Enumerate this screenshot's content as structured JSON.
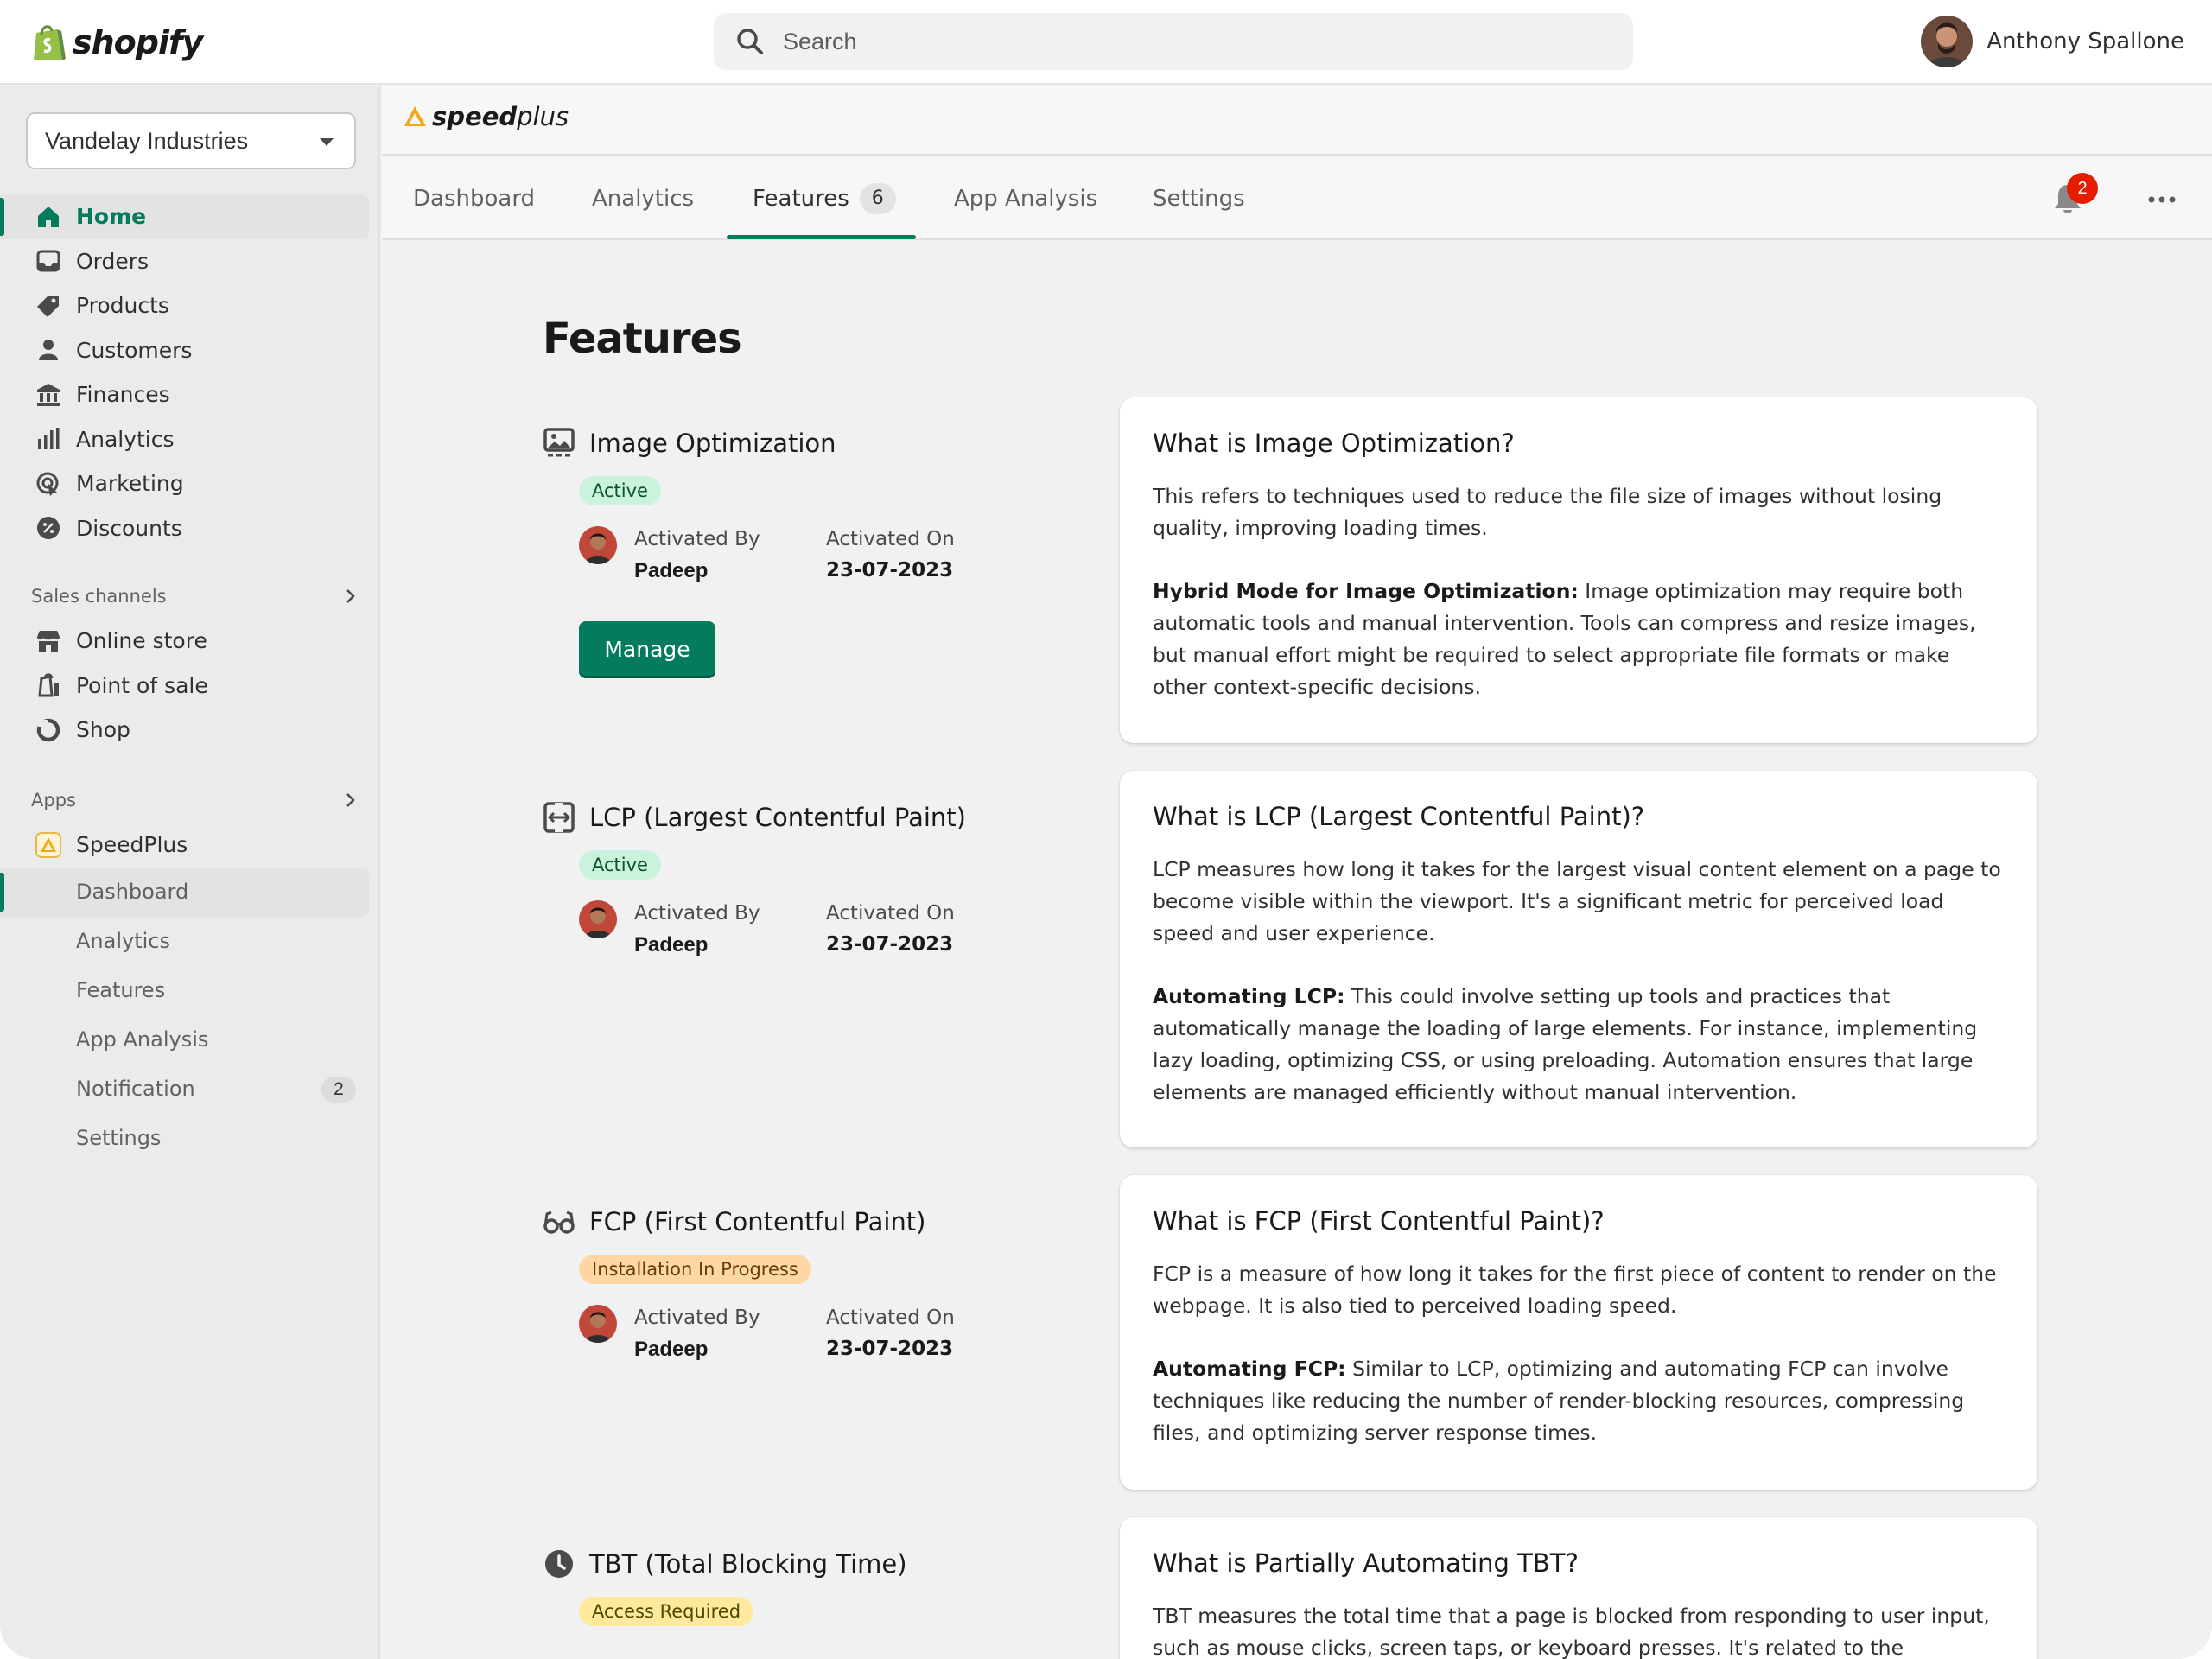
{
  "topbar": {
    "brand": "shopify",
    "search_placeholder": "Search",
    "user_name": "Anthony Spallone"
  },
  "sidebar": {
    "store": "Vandelay Industries",
    "items": [
      {
        "label": "Home",
        "icon": "home-icon"
      },
      {
        "label": "Orders",
        "icon": "inbox-icon"
      },
      {
        "label": "Products",
        "icon": "tag-icon"
      },
      {
        "label": "Customers",
        "icon": "person-icon"
      },
      {
        "label": "Finances",
        "icon": "bank-icon"
      },
      {
        "label": "Analytics",
        "icon": "bar-chart-icon"
      },
      {
        "label": "Marketing",
        "icon": "target-icon"
      },
      {
        "label": "Discounts",
        "icon": "discount-icon"
      }
    ],
    "sales_channels_label": "Sales channels",
    "channels": [
      {
        "label": "Online store",
        "icon": "store-icon"
      },
      {
        "label": "Point of sale",
        "icon": "pos-icon"
      },
      {
        "label": "Shop",
        "icon": "shop-icon"
      }
    ],
    "apps_label": "Apps",
    "app_name": "SpeedPlus",
    "app_items": [
      {
        "label": "Dashboard"
      },
      {
        "label": "Analytics"
      },
      {
        "label": "Features"
      },
      {
        "label": "App Analysis"
      },
      {
        "label": "Notification",
        "count": "2"
      },
      {
        "label": "Settings"
      }
    ]
  },
  "app": {
    "logo_bold": "speed",
    "logo_light": "plus",
    "tabs": [
      {
        "label": "Dashboard"
      },
      {
        "label": "Analytics"
      },
      {
        "label": "Features",
        "badge": "6"
      },
      {
        "label": "App Analysis"
      },
      {
        "label": "Settings"
      }
    ],
    "notification_count": "2"
  },
  "page": {
    "title": "Features",
    "activated_by_label": "Activated By",
    "activated_on_label": "Activated On",
    "features": [
      {
        "name": "Image Optimization",
        "icon": "image-icon",
        "status": "Active",
        "activated_by": "Padeep",
        "activated_on": "23-07-2023",
        "button": "Manage"
      },
      {
        "name": "LCP (Largest Contentful Paint)",
        "icon": "resize-arrows-icon",
        "status": "Active",
        "activated_by": "Padeep",
        "activated_on": "23-07-2023"
      },
      {
        "name": "FCP (First Contentful Paint)",
        "icon": "glasses-icon",
        "status": "Installation In Progress",
        "activated_by": "Padeep",
        "activated_on": "23-07-2023"
      },
      {
        "name": "TBT (Total Blocking Time)",
        "icon": "clock-icon",
        "status": "Access Required"
      }
    ],
    "cards": [
      {
        "title": "What is Image Optimization?",
        "p1": "This refers to techniques used to reduce the file size of images without losing quality, improving loading times.",
        "p2_bold": "Hybrid Mode for Image Optimization:",
        "p2": " Image optimization may require both automatic tools and manual intervention. Tools can compress and resize images, but manual effort might be required to select appropriate file formats or make other context-specific decisions."
      },
      {
        "title": "What is LCP (Largest Contentful Paint)?",
        "p1": "LCP measures how long it takes for the largest visual content element on a page to become visible within the viewport. It's a significant metric for perceived load speed and user experience.",
        "p2_bold": "Automating LCP:",
        "p2": " This could involve setting up tools and practices that automatically manage the loading of large elements. For instance, implementing lazy loading, optimizing CSS, or using preloading. Automation ensures that large elements are managed efficiently without manual intervention."
      },
      {
        "title": "What is FCP (First Contentful Paint)?",
        "p1": "FCP is a measure of how long it takes for the first piece of content to render on the webpage. It is also tied to perceived loading speed.",
        "p2_bold": "Automating FCP:",
        "p2": " Similar to LCP, optimizing and automating FCP can involve techniques like reducing the number of render-blocking resources, compressing files, and optimizing server response times."
      },
      {
        "title": "What is Partially Automating TBT?",
        "p1": "TBT measures the total time that a page is blocked from responding to user input, such as mouse clicks, screen taps, or keyboard presses. It's related to the interactivity of a"
      }
    ]
  },
  "colors": {
    "accent": "#047b5d",
    "active_bg": "#c9f3dc",
    "progress_bg": "#ffd6a4",
    "access_bg": "#ffe99c",
    "notification_red": "#e51c00"
  }
}
